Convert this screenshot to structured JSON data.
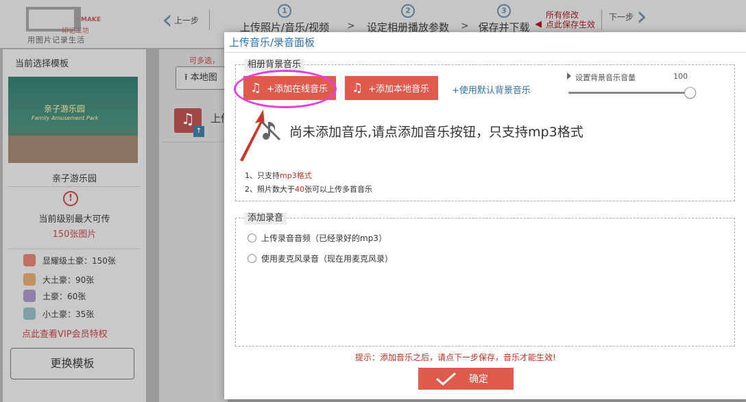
{
  "header": {
    "logo_make": "MAKE",
    "logo_brand": "印记工坊",
    "logo_slogan": "用图片记录生活",
    "back_label": "上一步",
    "next_label": "下一步",
    "steps": [
      {
        "num": "1",
        "label": "上传照片/音乐/视频"
      },
      {
        "num": "2",
        "label": "设定相册播放参数"
      },
      {
        "num": "3",
        "label": "保存并下载"
      }
    ],
    "step_separator": ">",
    "save_note_line1": "所有修改",
    "save_note_line2": "点此保存生效"
  },
  "sidebar": {
    "title": "当前选择模板",
    "template_name": "亲子游乐园",
    "thumb_text_cn": "亲子游乐园",
    "thumb_text_en": "Family Amusement Park",
    "level_label": "当前级别最大可传",
    "level_limit": "150张图片",
    "tiers": [
      {
        "label": "显耀级土豪：150张",
        "color": "#c07060"
      },
      {
        "label": "大土豪：90张",
        "color": "#c09060"
      },
      {
        "label": "土豪：60张",
        "color": "#9080a8"
      },
      {
        "label": "小土豪：35张",
        "color": "#80a0a8"
      }
    ],
    "vip_link": "点此查看VIP会员特权",
    "change_button": "更换模板"
  },
  "background_main": {
    "multi_hint": "可多选，",
    "local_button": "本地图",
    "upload_label": "上传"
  },
  "modal": {
    "title": "上传音乐/录音面板",
    "music_section": {
      "legend": "相册背景音乐",
      "add_online_button": "+添加在线音乐",
      "add_local_button": "+添加本地音乐",
      "default_music_link": "+使用默认背景音乐",
      "volume_label": "设置背景音乐音量",
      "volume_value": "100",
      "volume_fraction": 1.0,
      "empty_message": "尚未添加音乐,请点添加音乐按钮，只支持mp3格式",
      "rule1_prefix": "1、只支持",
      "rule1_highlight": "mp3格式",
      "rule2_prefix": "2、照片数大于",
      "rule2_highlight": "40",
      "rule2_suffix": "张可以上传多首音乐"
    },
    "recording_section": {
      "legend": "添加录音",
      "option_upload": "上传录音音频（已经录好的mp3）",
      "option_mic": "使用麦克风录音（现在用麦克风录）"
    },
    "tip": "提示：添加音乐之后，请点下一步保存，音乐才能生效!",
    "confirm_button": "确定"
  },
  "colors": {
    "accent_red": "#e05a4e",
    "link_blue": "#2f6fa5",
    "highlight_magenta": "#e53ee0",
    "warning_red": "#c03020"
  }
}
